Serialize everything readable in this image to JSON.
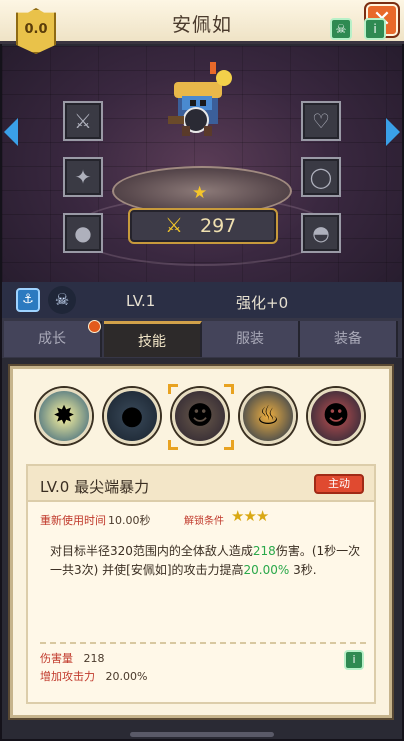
{
  "window": {
    "title": "安佩如",
    "close_label": "✕"
  },
  "hero": {
    "medal_value": "0.0",
    "power": "297",
    "level": "LV.1",
    "enhance": "强化+0"
  },
  "tabs": [
    {
      "label": "成长"
    },
    {
      "label": "技能"
    },
    {
      "label": "服装"
    },
    {
      "label": "装备"
    }
  ],
  "active_tab": "技能",
  "skill": {
    "name": "LV.0  最尖端暴力",
    "type_badge": "主动",
    "cooldown_label": "重新使用时间",
    "cooldown_value": "10.00秒",
    "unlock_label": "解锁条件",
    "unlock_stars": "★★★",
    "desc_1": "对目标半径320范围内的全体敌人造成",
    "desc_dmg": "218",
    "desc_2": "伤害。(1秒一次 一共3次) 并使[安佩如]的攻击力提高",
    "desc_pct": "20.00%",
    "desc_3": " 3秒.",
    "stat_damage_label": "伤害量",
    "stat_damage_value": "218",
    "stat_atk_label": "增加攻击力",
    "stat_atk_value": "20.00%"
  },
  "colors": {
    "accent": "#e8692a",
    "selected": "#e8a220",
    "green": "#2aa84a",
    "red": "#c0392b"
  }
}
